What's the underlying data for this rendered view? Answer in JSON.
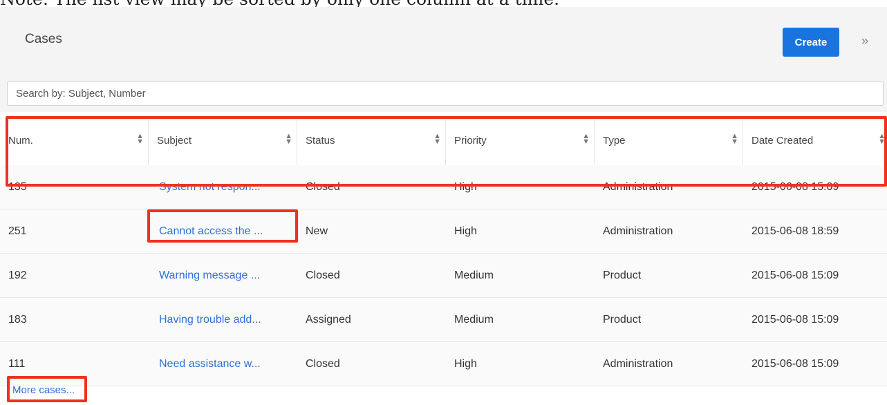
{
  "note": "Note: The list view may be sorted by only one column at a time.",
  "header": {
    "title": "Cases",
    "create_label": "Create",
    "expand_icon": "double-chevron-right-icon",
    "expand_glyph": "»"
  },
  "search": {
    "placeholder": "Search by: Subject, Number"
  },
  "table": {
    "columns": [
      "Num.",
      "Subject",
      "Status",
      "Priority",
      "Type",
      "Date Created"
    ],
    "sort_icon": "sort-updown-icon",
    "rows": [
      {
        "num": "135",
        "subject": "System not respon...",
        "status": "Closed",
        "priority": "High",
        "type": "Administration",
        "date": "2015-06-08 15:09"
      },
      {
        "num": "251",
        "subject": "Cannot access the ...",
        "status": "New",
        "priority": "High",
        "type": "Administration",
        "date": "2015-06-08 18:59"
      },
      {
        "num": "192",
        "subject": "Warning message ...",
        "status": "Closed",
        "priority": "Medium",
        "type": "Product",
        "date": "2015-06-08 15:09"
      },
      {
        "num": "183",
        "subject": "Having trouble add...",
        "status": "Assigned",
        "priority": "Medium",
        "type": "Product",
        "date": "2015-06-08 15:09"
      },
      {
        "num": "111",
        "subject": "Need assistance w...",
        "status": "Closed",
        "priority": "High",
        "type": "Administration",
        "date": "2015-06-08 15:09"
      }
    ]
  },
  "more_link": "More cases...",
  "colors": {
    "accent": "#1a74e0",
    "link": "#2e6fd6",
    "highlight": "#f0311f"
  }
}
